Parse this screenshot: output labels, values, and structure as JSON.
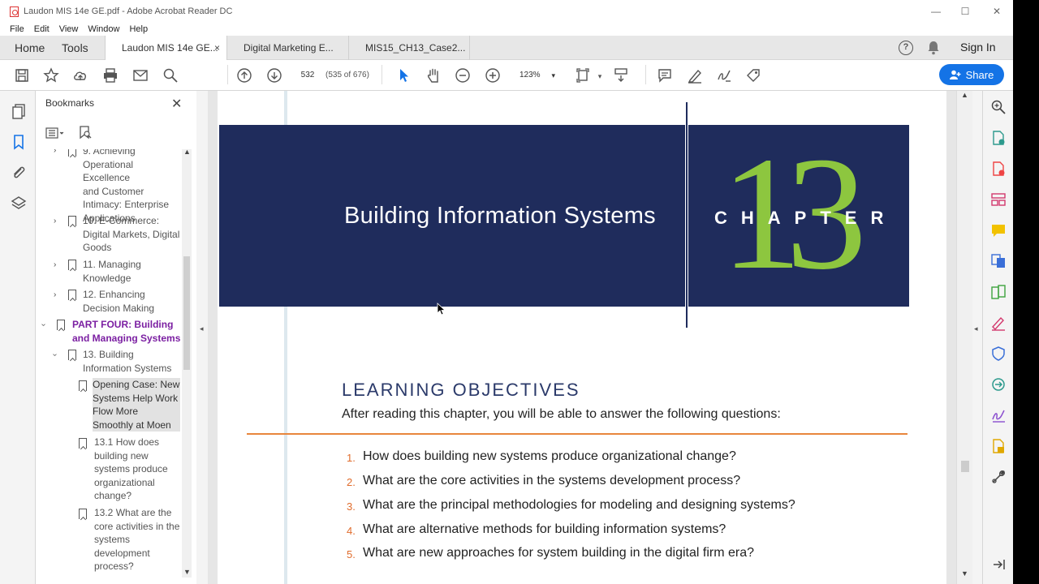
{
  "window": {
    "title": "Laudon MIS 14e GE.pdf - Adobe Acrobat Reader DC",
    "minimize": "—",
    "maximize": "☐",
    "close": "✕"
  },
  "menu": [
    "File",
    "Edit",
    "View",
    "Window",
    "Help"
  ],
  "tabs": {
    "home": "Home",
    "tools": "Tools",
    "documents": [
      {
        "label": "Laudon MIS 14e GE...",
        "active": true,
        "close": "×"
      },
      {
        "label": "Digital Marketing E...",
        "active": false
      },
      {
        "label": "MIS15_CH13_Case2...",
        "active": false
      }
    ],
    "help": "?",
    "sign_in": "Sign In"
  },
  "toolbar": {
    "page_number": "532",
    "page_count": "(535 of 676)",
    "zoom": "123%",
    "share_label": "Share"
  },
  "bookmarks": {
    "title": "Bookmarks",
    "close": "✕",
    "items": [
      {
        "text": "9. Achieving",
        "cut": true
      },
      {
        "text": "Operational Excellence"
      },
      {
        "text": "and Customer"
      },
      {
        "text": "Intimacy: Enterprise"
      },
      {
        "text": "Applications"
      },
      {
        "text": "10. E-Commerce:"
      },
      {
        "text": "Digital Markets, Digital"
      },
      {
        "text": "Goods"
      },
      {
        "text": "11. Managing"
      },
      {
        "text": "Knowledge"
      },
      {
        "text": "12. Enhancing"
      },
      {
        "text": "Decision Making"
      },
      {
        "text": "PART FOUR: Building"
      },
      {
        "text": "and Managing Systems"
      },
      {
        "text": "13. Building"
      },
      {
        "text": "Information Systems"
      },
      {
        "text": "Opening Case: New"
      },
      {
        "text": "Systems Help Work"
      },
      {
        "text": "Flow More"
      },
      {
        "text": "Smoothly at Moen"
      },
      {
        "text": "13.1 How does"
      },
      {
        "text": "building new"
      },
      {
        "text": "systems produce"
      },
      {
        "text": "organizational"
      },
      {
        "text": "change?"
      },
      {
        "text": "13.2 What are the"
      },
      {
        "text": "core activities in the"
      },
      {
        "text": "systems"
      },
      {
        "text": "development"
      },
      {
        "text": "process?"
      }
    ]
  },
  "document": {
    "chapter_title": "Building Information Systems",
    "chapter_word": "CHAPTER",
    "chapter_number": "13",
    "learning_heading": "LEARNING OBJECTIVES",
    "intro": "After reading this chapter, you will be able to answer the following questions:",
    "objectives": [
      {
        "num": "1.",
        "text": "How does building new systems produce organizational change?"
      },
      {
        "num": "2.",
        "text": "What are the core activities in the systems development process?"
      },
      {
        "num": "3.",
        "text": "What are the principal methodologies for modeling and designing systems?"
      },
      {
        "num": "4.",
        "text": "What are alternative methods for building information systems?"
      },
      {
        "num": "5.",
        "text": "What are new approaches for system building in the digital firm era?"
      }
    ]
  },
  "colors": {
    "banner": "#1f2c5c",
    "chapter_number": "#8dc63f",
    "rule": "#e8863c",
    "part_bookmark": "#7b1fa2",
    "share": "#1473e6"
  }
}
